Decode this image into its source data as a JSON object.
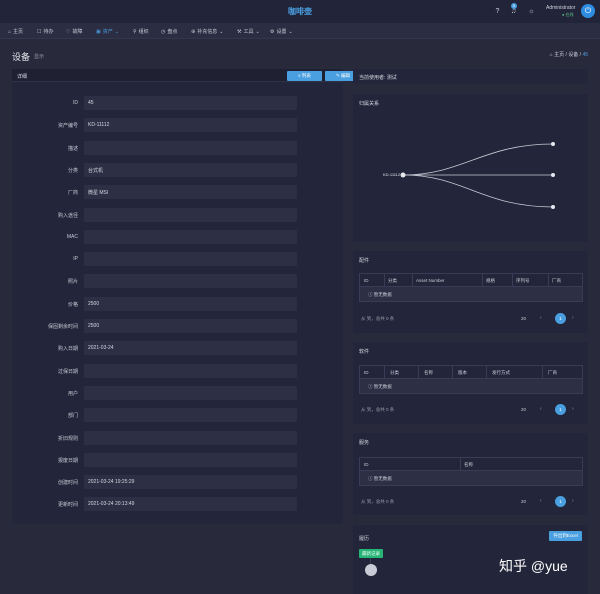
{
  "topbar": {
    "brand": "咖啡壶",
    "user_name": "Administrator",
    "user_status": "● 在线",
    "notif_count": "0"
  },
  "menu": [
    {
      "icon": "⌂",
      "label": "主页",
      "arrow": ""
    },
    {
      "icon": "☐",
      "label": "待办",
      "arrow": ""
    },
    {
      "icon": "♡",
      "label": "故障",
      "arrow": ""
    },
    {
      "icon": "▣",
      "label": "资产",
      "arrow": "⌄"
    },
    {
      "icon": "⚲",
      "label": "组织",
      "arrow": ""
    },
    {
      "icon": "◷",
      "label": "盘点",
      "arrow": ""
    },
    {
      "icon": "⊕",
      "label": "补充信息",
      "arrow": "⌄"
    },
    {
      "icon": "⚒",
      "label": "工具",
      "arrow": "⌄"
    },
    {
      "icon": "⚙",
      "label": "设置",
      "arrow": "⌄"
    }
  ],
  "page": {
    "title": "设备",
    "subtitle": "显示"
  },
  "breadcrumb": {
    "home": "⌂ 主页",
    "sep1": "/",
    "section": "设备",
    "sep2": "/",
    "current": "45"
  },
  "detail": {
    "title": "详细",
    "list_button": "≡ 列表",
    "edit_button": "✎ 编辑",
    "fields": [
      {
        "label": "ID",
        "value": "45"
      },
      {
        "label": "资产编号",
        "value": "KD-11112"
      },
      {
        "label": "描述",
        "value": ""
      },
      {
        "label": "分类",
        "value": "台式机"
      },
      {
        "label": "厂商",
        "value": "微星 MSI"
      },
      {
        "label": "购入途径",
        "value": ""
      },
      {
        "label": "MAC",
        "value": ""
      },
      {
        "label": "IP",
        "value": ""
      },
      {
        "label": "照片",
        "value": ""
      },
      {
        "label": "价格",
        "value": "2500"
      },
      {
        "label": "保固剩余时间",
        "value": "2500"
      },
      {
        "label": "购入日期",
        "value": "2021-03-24"
      },
      {
        "label": "过保日期",
        "value": ""
      },
      {
        "label": "用户",
        "value": ""
      },
      {
        "label": "部门",
        "value": ""
      },
      {
        "label": "折旧规则",
        "value": ""
      },
      {
        "label": "报废日期",
        "value": ""
      },
      {
        "label": "创建时间",
        "value": "2021-03-24 19:25:29"
      },
      {
        "label": "更新时间",
        "value": "2021-03-24 20:13:49"
      }
    ]
  },
  "current_user": {
    "label": "当前使用者:",
    "value": "测试"
  },
  "relations": {
    "title": "归属关系",
    "root": "KD-11112",
    "children": [
      "",
      "",
      ""
    ]
  },
  "parts": {
    "title": "配件",
    "columns": [
      "ID",
      "分类",
      "Asset Number",
      "规格",
      "序列号",
      "厂商"
    ],
    "empty": "ⓘ 暂无数据",
    "total": "从 到，总共 0 条",
    "page_size": "20",
    "prev": "‹",
    "next": "›",
    "page": "1"
  },
  "software": {
    "title": "软件",
    "columns": [
      "ID",
      "分类",
      "名称",
      "版本",
      "发行方式",
      "厂商"
    ],
    "empty": "ⓘ 暂无数据",
    "total": "从 到，总共 0 条",
    "page_size": "20",
    "prev": "‹",
    "next": "›",
    "page": "1"
  },
  "services": {
    "title": "服务",
    "columns": [
      "ID",
      "名称"
    ],
    "empty": "ⓘ 暂无数据",
    "total": "从 到，总共 0 条",
    "page_size": "20",
    "prev": "‹",
    "next": "›",
    "page": "1"
  },
  "history": {
    "title": "履历",
    "export_button": "导出到Excel",
    "latest_badge": "最新记录"
  },
  "watermark": "知乎 @yue",
  "colors": {
    "accent": "#4a9fe0",
    "success": "#26b575",
    "background": "#282a3c",
    "card": "#23253a"
  }
}
